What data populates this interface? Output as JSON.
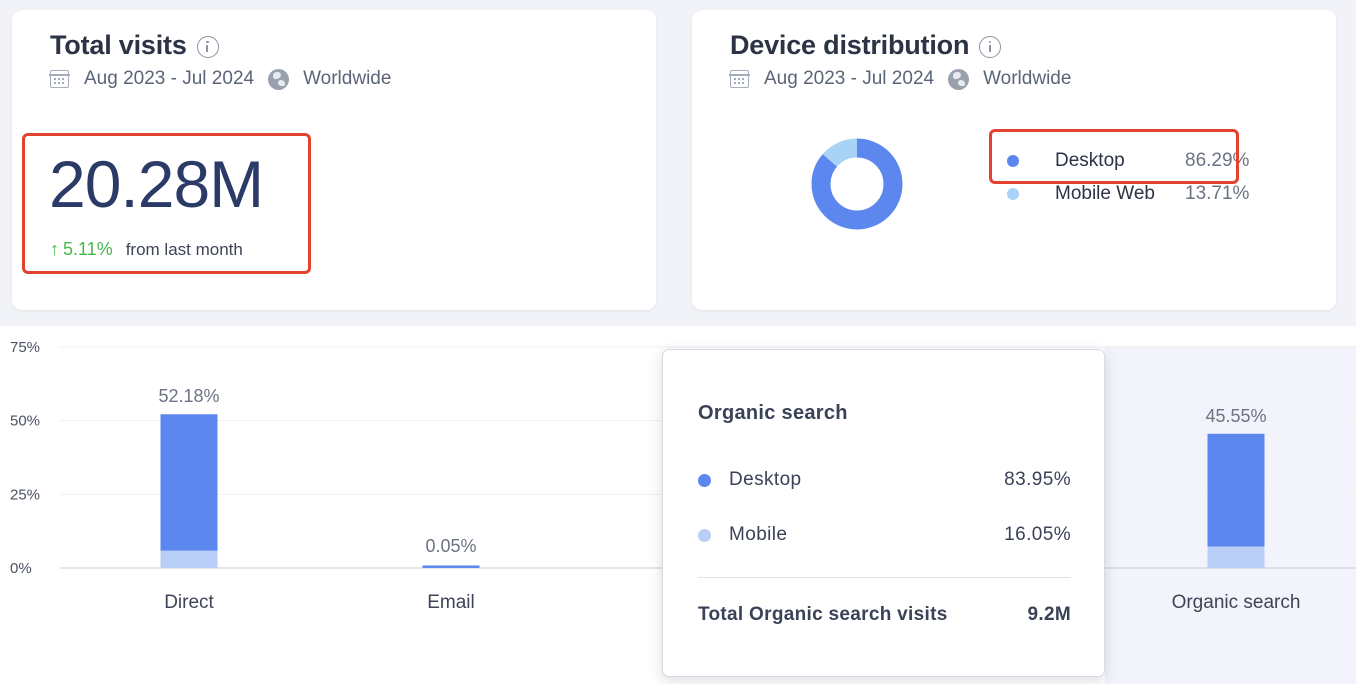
{
  "total_visits": {
    "title": "Total visits",
    "date_range": "Aug 2023 - Jul 2024",
    "region": "Worldwide",
    "value": "20.28M",
    "change_pct": "5.11%",
    "change_text": "from last month",
    "change_direction": "up"
  },
  "device_distribution": {
    "title": "Device distribution",
    "date_range": "Aug 2023 - Jul 2024",
    "region": "Worldwide",
    "items": [
      {
        "name": "Desktop",
        "pct_label": "86.29%",
        "value": 86.29,
        "color": "#5b87ee"
      },
      {
        "name": "Mobile Web",
        "pct_label": "13.71%",
        "value": 13.71,
        "color": "#a9d2f7"
      }
    ]
  },
  "chart_data": [
    {
      "type": "pie",
      "variant": "donut",
      "categories": [
        "Desktop",
        "Mobile Web"
      ],
      "values": [
        86.29,
        13.71
      ],
      "colors": [
        "#5b87ee",
        "#a9d2f7"
      ]
    },
    {
      "type": "bar",
      "stacked": true,
      "categories": [
        "Direct",
        "Email",
        "Organic search"
      ],
      "value_labels": [
        "52.18%",
        "0.05%",
        "45.55%"
      ],
      "totals": [
        52.18,
        0.05,
        45.55
      ],
      "series": [
        {
          "name": "Desktop",
          "values": [
            46.3,
            0.04,
            38.24
          ],
          "color": "#5b87ee"
        },
        {
          "name": "Mobile",
          "values": [
            5.88,
            0.01,
            7.31
          ],
          "color": "#b8cef6"
        }
      ],
      "y_ticks": [
        "0%",
        "25%",
        "50%",
        "75%"
      ],
      "ylim": [
        0,
        75
      ],
      "highlighted_category": "Organic search",
      "grid": true
    }
  ],
  "tooltip": {
    "title": "Organic search",
    "rows": [
      {
        "label": "Desktop",
        "value": "83.95%",
        "color": "#5b87ee"
      },
      {
        "label": "Mobile",
        "value": "16.05%",
        "color": "#b8cef6"
      }
    ],
    "total_label": "Total Organic search visits",
    "total_value": "9.2M"
  }
}
